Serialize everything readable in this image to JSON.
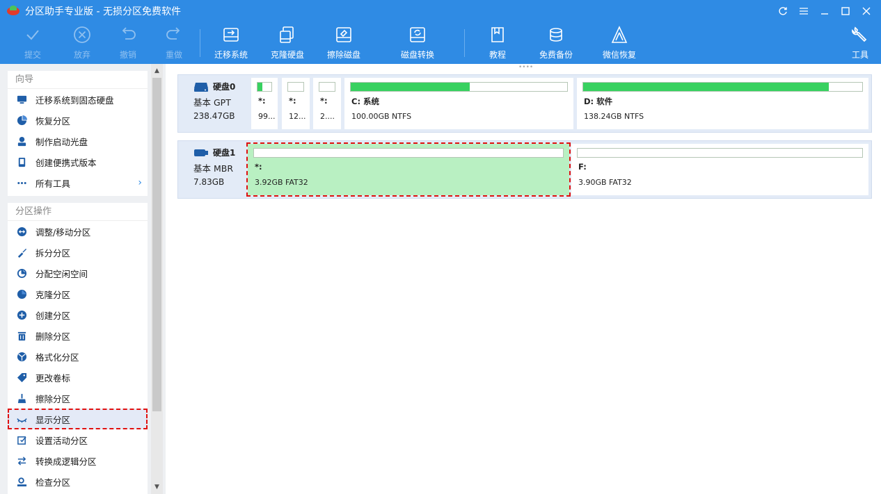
{
  "window": {
    "title": "分区助手专业版 - 无损分区免费软件"
  },
  "toolbar": {
    "items": [
      {
        "label": "提交",
        "icon": "check-icon",
        "enabled": false
      },
      {
        "label": "放弃",
        "icon": "discard-icon",
        "enabled": false
      },
      {
        "label": "撤销",
        "icon": "undo-icon",
        "enabled": false
      },
      {
        "label": "重做",
        "icon": "redo-icon",
        "enabled": false
      },
      {
        "label": "迁移系统",
        "icon": "migrate-os-icon",
        "enabled": true
      },
      {
        "label": "克隆硬盘",
        "icon": "clone-disk-icon",
        "enabled": true
      },
      {
        "label": "擦除磁盘",
        "icon": "wipe-disk-icon",
        "enabled": true
      },
      {
        "label": "磁盘转换",
        "icon": "convert-disk-icon",
        "enabled": true
      },
      {
        "label": "教程",
        "icon": "tutorial-icon",
        "enabled": true
      },
      {
        "label": "免费备份",
        "icon": "backup-icon",
        "enabled": true
      },
      {
        "label": "微信恢复",
        "icon": "recovery-icon",
        "enabled": true
      },
      {
        "label": "工具",
        "icon": "tools-icon",
        "enabled": true
      }
    ]
  },
  "sidebar": {
    "wizard": {
      "title": "向导",
      "items": [
        {
          "label": "迁移系统到固态硬盘",
          "icon": "migrate-ssd-icon"
        },
        {
          "label": "恢复分区",
          "icon": "recover-partition-icon"
        },
        {
          "label": "制作启动光盘",
          "icon": "bootable-media-icon"
        },
        {
          "label": "创建便携式版本",
          "icon": "portable-version-icon"
        },
        {
          "label": "所有工具",
          "icon": "all-tools-icon"
        }
      ]
    },
    "operations": {
      "title": "分区操作",
      "items": [
        {
          "label": "调整/移动分区",
          "icon": "resize-partition-icon"
        },
        {
          "label": "拆分分区",
          "icon": "split-partition-icon"
        },
        {
          "label": "分配空闲空间",
          "icon": "allocate-space-icon"
        },
        {
          "label": "克隆分区",
          "icon": "clone-partition-icon"
        },
        {
          "label": "创建分区",
          "icon": "create-partition-icon"
        },
        {
          "label": "删除分区",
          "icon": "delete-partition-icon"
        },
        {
          "label": "格式化分区",
          "icon": "format-partition-icon"
        },
        {
          "label": "更改卷标",
          "icon": "change-label-icon"
        },
        {
          "label": "擦除分区",
          "icon": "wipe-partition-icon"
        },
        {
          "label": "显示分区",
          "icon": "unhide-partition-icon"
        },
        {
          "label": "设置活动分区",
          "icon": "set-active-icon"
        },
        {
          "label": "转换成逻辑分区",
          "icon": "convert-logical-icon"
        },
        {
          "label": "检查分区",
          "icon": "check-partition-icon"
        }
      ]
    }
  },
  "disks": [
    {
      "name": "硬盘0",
      "type": "基本 GPT",
      "size": "238.47GB",
      "partitions": [
        {
          "name": "*:",
          "info": "99...",
          "used_fraction": 0.35
        },
        {
          "name": "*:",
          "info": "12...",
          "used_fraction": 0
        },
        {
          "name": "*:",
          "info": "2....",
          "used_fraction": 0
        },
        {
          "name": "C: 系统",
          "info": "100.00GB NTFS",
          "used_fraction": 0.55
        },
        {
          "name": "D: 软件",
          "info": "138.24GB NTFS",
          "used_fraction": 0.88
        }
      ]
    },
    {
      "name": "硬盘1",
      "type": "基本 MBR",
      "size": "7.83GB",
      "partitions": [
        {
          "name": "*:",
          "info": "3.92GB FAT32",
          "used_fraction": 0,
          "selected": true
        },
        {
          "name": "F:",
          "info": "3.90GB FAT32",
          "used_fraction": 0
        }
      ]
    }
  ],
  "colors": {
    "accent": "#2f8be4",
    "used_bar": "#38d160",
    "selected_partition": "#b9f0c2",
    "highlight_outline": "#e01010"
  }
}
